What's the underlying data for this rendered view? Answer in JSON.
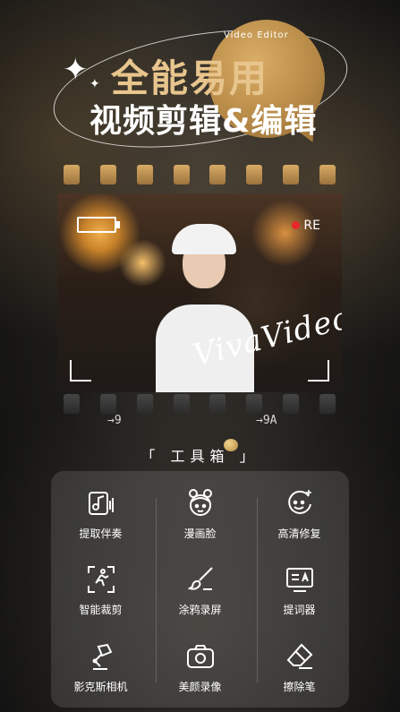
{
  "header": {
    "brand_tag": "Video Editor",
    "title_line1": "全能易用",
    "title_line2": "视频剪辑&编辑"
  },
  "film": {
    "rec_label": "RE",
    "watermark": "VivaVideo",
    "frame_label_left": "→9",
    "frame_label_right": "→9A"
  },
  "toolbox": {
    "title": "「 工具箱 」",
    "tools": [
      {
        "label": "提取伴奏",
        "icon": "music-note-icon"
      },
      {
        "label": "漫画脸",
        "icon": "cartoon-face-icon"
      },
      {
        "label": "高清修复",
        "icon": "sparkle-smile-icon"
      },
      {
        "label": "智能裁剪",
        "icon": "running-crop-icon"
      },
      {
        "label": "涂鸦录屏",
        "icon": "brush-icon"
      },
      {
        "label": "提词器",
        "icon": "teleprompter-icon"
      },
      {
        "label": "影克斯相机",
        "icon": "desk-lamp-icon"
      },
      {
        "label": "美颜录像",
        "icon": "camera-icon"
      },
      {
        "label": "擦除笔",
        "icon": "eraser-icon"
      }
    ]
  },
  "colors": {
    "gold": "#d9ad66",
    "rec_red": "#e8262b"
  }
}
